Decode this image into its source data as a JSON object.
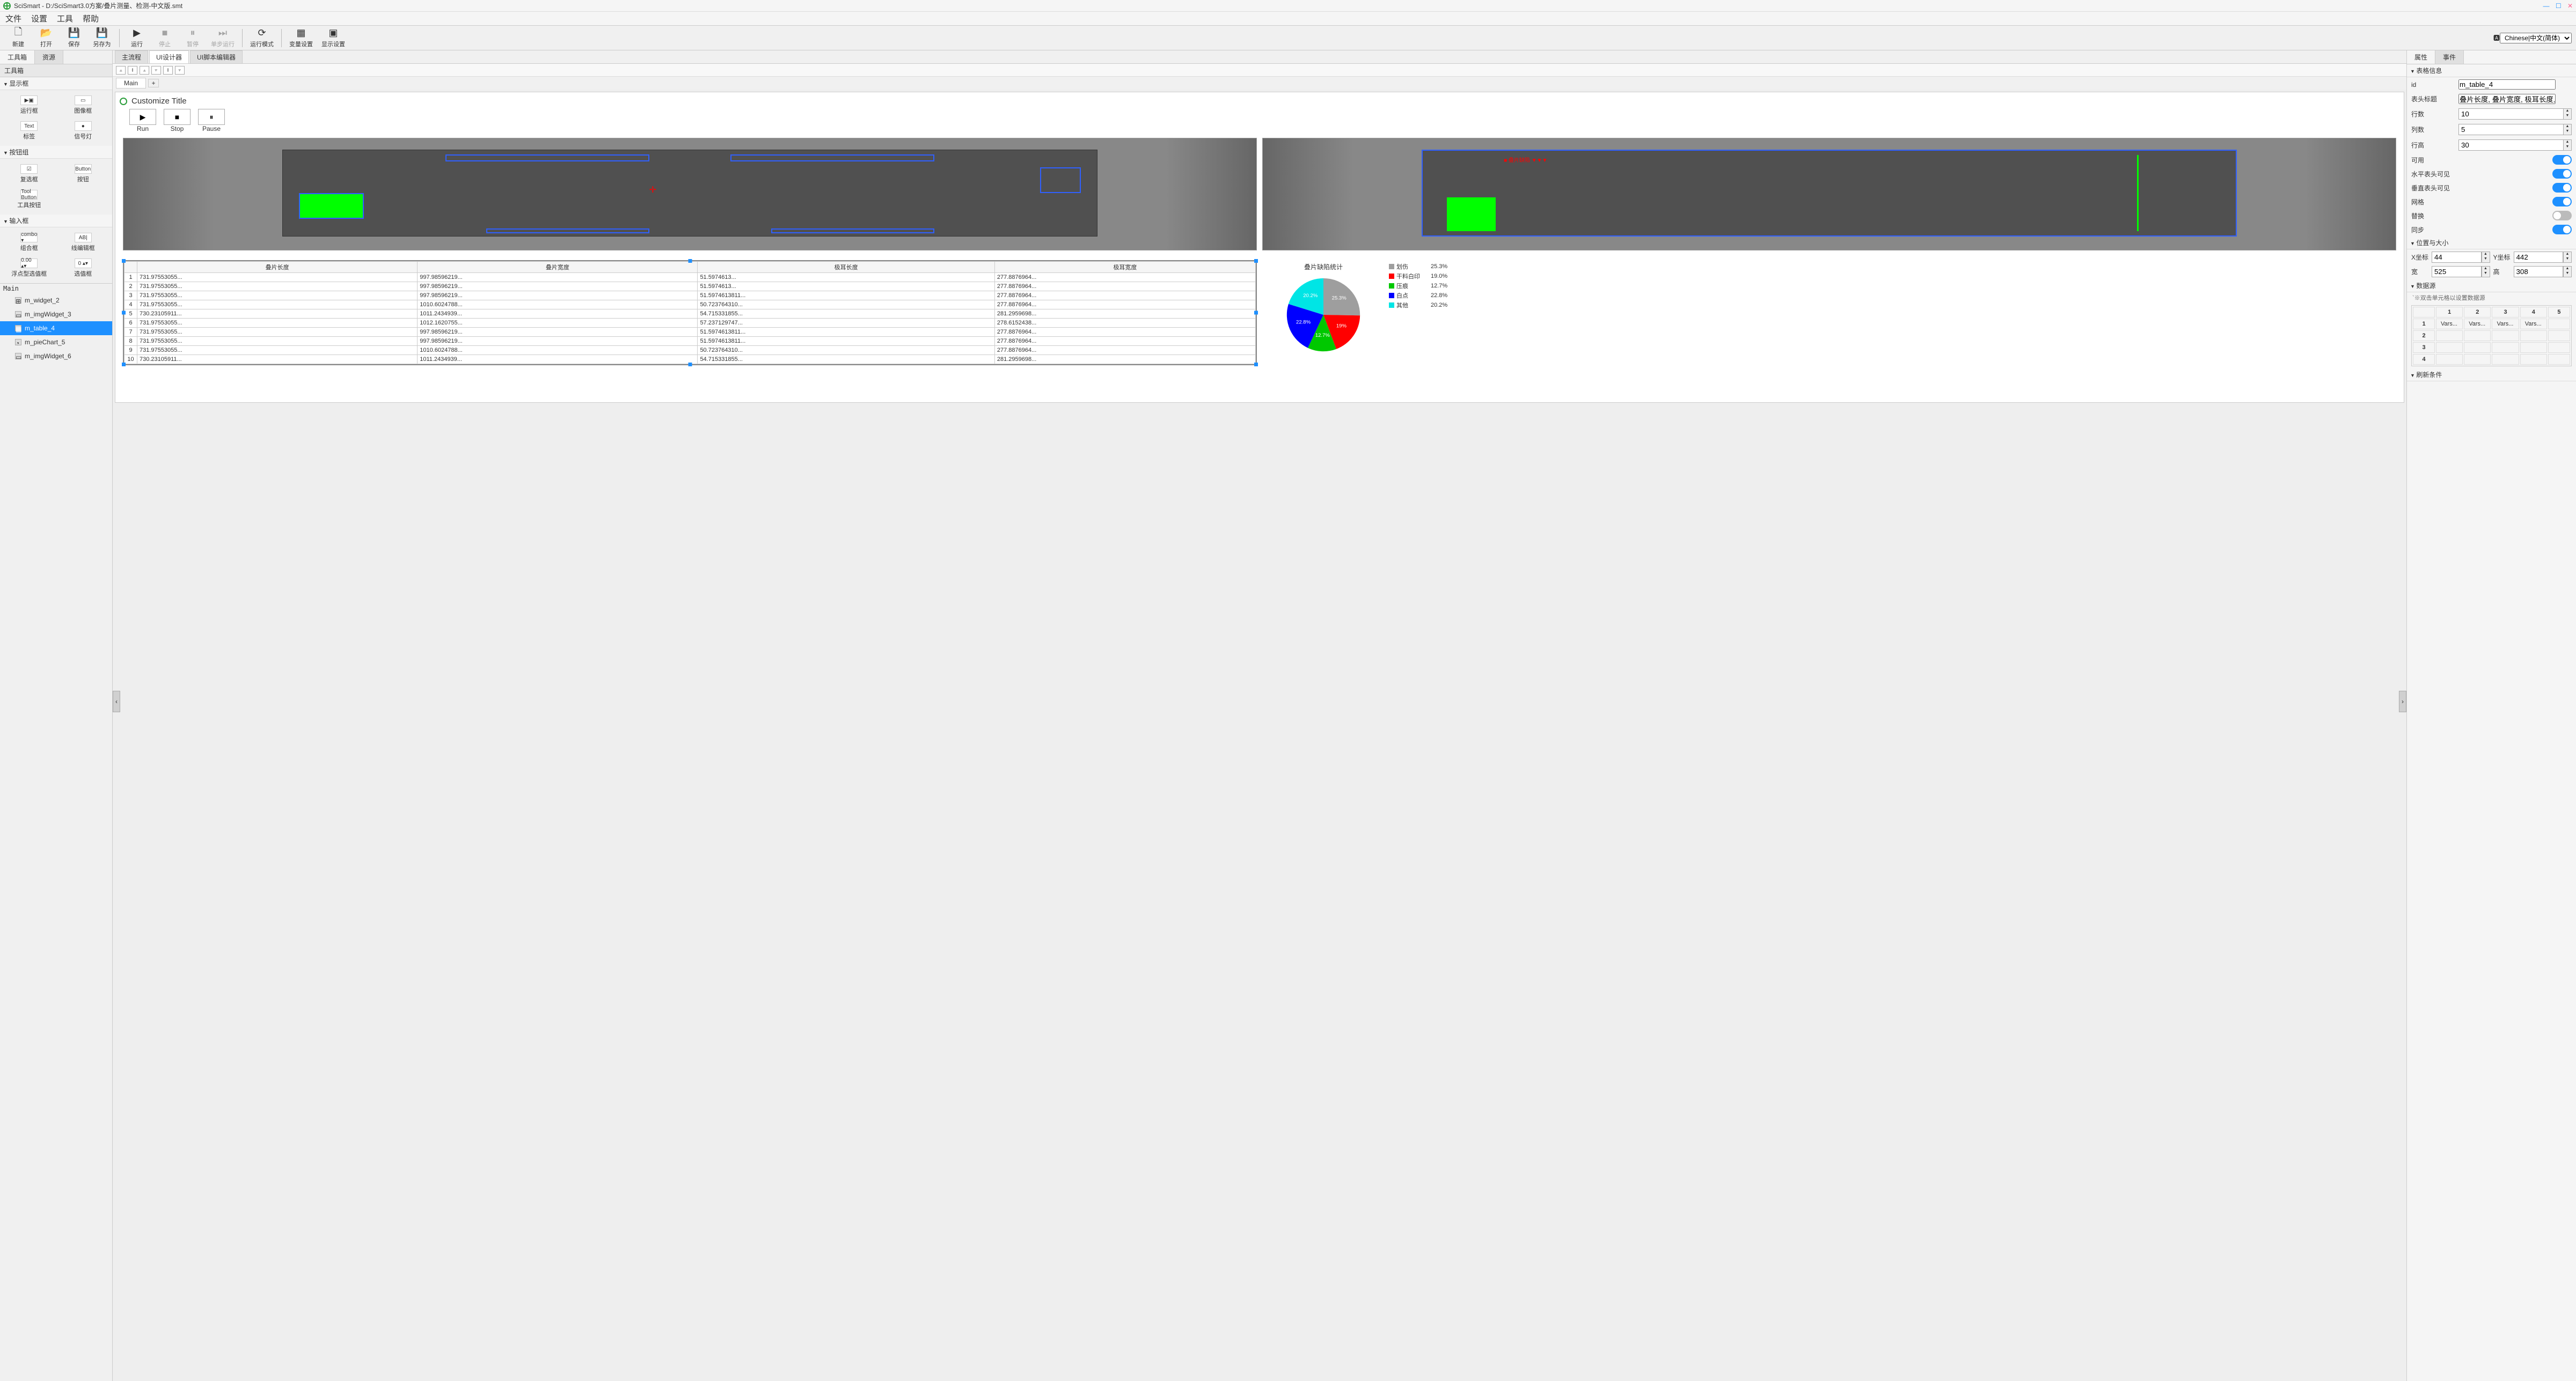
{
  "titlebar": {
    "app": "SciSmart",
    "path": "D:/SciSmart3.0方案/叠片测量、检测-中文版.smt"
  },
  "menubar": [
    "文件",
    "设置",
    "工具",
    "帮助"
  ],
  "toolbar": [
    {
      "icon": "🗋",
      "label": "新建",
      "enabled": true
    },
    {
      "icon": "📂",
      "label": "打开",
      "enabled": true
    },
    {
      "icon": "💾",
      "label": "保存",
      "enabled": true
    },
    {
      "icon": "💾",
      "label": "另存为",
      "enabled": true
    },
    {
      "sep": true
    },
    {
      "icon": "▶",
      "label": "运行",
      "enabled": true
    },
    {
      "icon": "■",
      "label": "停止",
      "enabled": false
    },
    {
      "icon": "⏸",
      "label": "暂停",
      "enabled": false
    },
    {
      "icon": "⏭",
      "label": "单步运行",
      "enabled": false
    },
    {
      "sep": true
    },
    {
      "icon": "⟳",
      "label": "运行模式",
      "enabled": true
    },
    {
      "sep": true
    },
    {
      "icon": "▦",
      "label": "变量设置",
      "enabled": true
    },
    {
      "icon": "▣",
      "label": "显示设置",
      "enabled": true
    }
  ],
  "language": {
    "options": [
      "Chinese|中文(简体)"
    ],
    "selected": "Chinese|中文(简体)"
  },
  "left": {
    "tabs": [
      "工具箱",
      "资源"
    ],
    "active": "工具箱",
    "header": "工具箱",
    "groups": [
      {
        "title": "显示框",
        "items": [
          [
            "▶▣",
            "运行框"
          ],
          [
            "▭",
            "图像框"
          ],
          [
            "Text",
            "标签"
          ],
          [
            "●",
            "信号灯"
          ]
        ]
      },
      {
        "title": "按钮组",
        "items": [
          [
            "☑",
            "复选框"
          ],
          [
            "Button",
            "按钮"
          ],
          [
            "Tool Button",
            "工具按钮"
          ],
          [
            "",
            ""
          ]
        ]
      },
      {
        "title": "输入框",
        "items": [
          [
            "combo ▾",
            "组合框"
          ],
          [
            "AB|",
            "线编辑框"
          ],
          [
            "0.00 ▴▾",
            "浮点型选值框"
          ],
          [
            "0 ▴▾",
            "选值框"
          ]
        ]
      }
    ],
    "hierarchy_title": "Main",
    "hierarchy": [
      {
        "name": "m_widget_2",
        "ico": "⊞"
      },
      {
        "name": "m_imgWidget_3",
        "ico": "▭"
      },
      {
        "name": "m_table_4",
        "ico": "▦",
        "selected": true
      },
      {
        "name": "m_pieChart_5",
        "ico": "◔"
      },
      {
        "name": "m_imgWidget_6",
        "ico": "▭"
      }
    ]
  },
  "center": {
    "tabs": [
      "主流程",
      "UI设计器",
      "UI脚本编辑器"
    ],
    "active": "UI设计器",
    "page_tabs": [
      "Main"
    ],
    "add": "+",
    "customize_title": "Customize Title",
    "run_controls": [
      [
        "▶",
        "Run"
      ],
      [
        "■",
        "Stop"
      ],
      [
        "⏸",
        "Pause"
      ]
    ],
    "table": {
      "headers": [
        "",
        "叠片长度",
        "叠片宽度",
        "极耳长度",
        "极耳宽度"
      ],
      "rows": [
        [
          "1",
          "731.97553055...",
          "997.98596219...",
          "51.5974613...",
          "277.8876964..."
        ],
        [
          "2",
          "731.97553055...",
          "997.98596219...",
          "51.5974613...",
          "277.8876964..."
        ],
        [
          "3",
          "731.97553055...",
          "997.98596219...",
          "51.5974613811...",
          "277.8876964..."
        ],
        [
          "4",
          "731.97553055...",
          "1010.6024788...",
          "50.723764310...",
          "277.8876964..."
        ],
        [
          "5",
          "730.23105911...",
          "1011.2434939...",
          "54.715331855...",
          "281.2959698..."
        ],
        [
          "6",
          "731.97553055...",
          "1012.1620755...",
          "57.237129747...",
          "278.6152438..."
        ],
        [
          "7",
          "731.97553055...",
          "997.98596219...",
          "51.5974613811...",
          "277.8876964..."
        ],
        [
          "8",
          "731.97553055...",
          "997.98596219...",
          "51.5974613811...",
          "277.8876964..."
        ],
        [
          "9",
          "731.97553055...",
          "1010.6024788...",
          "50.723764310...",
          "277.8876964..."
        ],
        [
          "10",
          "730.23105911...",
          "1011.2434939...",
          "54.715331855...",
          "281.2959698..."
        ]
      ]
    },
    "pie_title": "叠片缺陷统计"
  },
  "chart_data": {
    "type": "pie",
    "title": "叠片缺陷统计",
    "series": [
      {
        "name": "划伤",
        "value": 25.3,
        "color": "#9e9e9e"
      },
      {
        "name": "干料白印",
        "value": 19.0,
        "color": "#ff0000"
      },
      {
        "name": "压痕",
        "value": 12.7,
        "color": "#00c800"
      },
      {
        "name": "白点",
        "value": 22.8,
        "color": "#0000ff"
      },
      {
        "name": "其他",
        "value": 20.2,
        "color": "#00e5e5"
      }
    ]
  },
  "right": {
    "tabs": [
      "属性",
      "事件"
    ],
    "active": "属性",
    "sec_table": "表格信息",
    "id_label": "id",
    "id": "m_table_4",
    "header_label": "表头标题",
    "header_val": "叠片长度, 叠片宽度, 极耳长度, 极耳宽度",
    "rows_label": "行数",
    "rows": "10",
    "cols_label": "列数",
    "cols": "5",
    "rowh_label": "行高",
    "rowh": "30",
    "tog": [
      [
        "可用",
        true
      ],
      [
        "水平表头可见",
        true
      ],
      [
        "垂直表头可见",
        true
      ],
      [
        "网格",
        true
      ],
      [
        "替换",
        false
      ],
      [
        "同步",
        true
      ]
    ],
    "sec_pos": "位置与大小",
    "pos": {
      "xl": "X坐标",
      "x": "44",
      "yl": "Y坐标",
      "y": "442",
      "wl": "宽",
      "w": "525",
      "hl": "高",
      "h": "308"
    },
    "sec_ds": "数据源",
    "ds_hint": "`※双击单元格以设置数据源",
    "ds_headers": [
      "",
      "1",
      "2",
      "3",
      "4",
      "5"
    ],
    "ds_rows": [
      [
        "1",
        "Vars...",
        "Vars...",
        "Vars...",
        "Vars...",
        ""
      ],
      [
        "2",
        "",
        "",
        "",
        "",
        ""
      ],
      [
        "3",
        "",
        "",
        "",
        "",
        ""
      ],
      [
        "4",
        "",
        "",
        "",
        "",
        ""
      ]
    ],
    "sec_refresh": "刷新条件"
  }
}
